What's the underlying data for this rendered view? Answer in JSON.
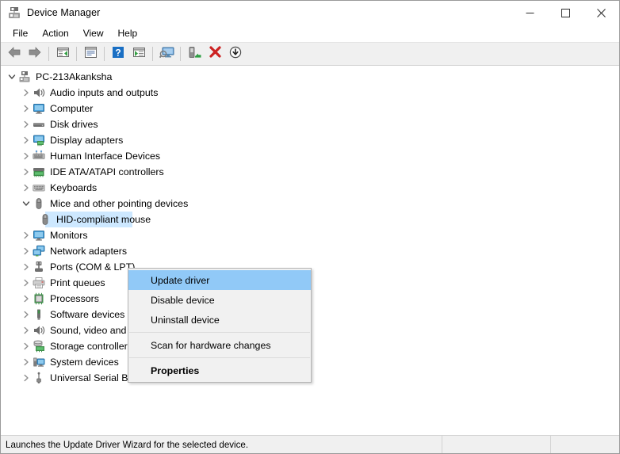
{
  "window": {
    "title": "Device Manager",
    "icon": "device-manager-icon"
  },
  "titlebar_buttons": {
    "minimize": "minimize-button",
    "maximize": "maximize-button",
    "close": "close-button"
  },
  "menubar": {
    "items": [
      {
        "label": "File"
      },
      {
        "label": "Action"
      },
      {
        "label": "View"
      },
      {
        "label": "Help"
      }
    ]
  },
  "toolbar": {
    "buttons": [
      {
        "name": "back-button",
        "icon": "left-arrow-icon"
      },
      {
        "name": "forward-button",
        "icon": "right-arrow-icon"
      },
      {
        "name": "separator-1",
        "icon": "separator"
      },
      {
        "name": "show-hide-console-tree-button",
        "icon": "console-tree-icon"
      },
      {
        "name": "separator-2",
        "icon": "separator"
      },
      {
        "name": "properties-button",
        "icon": "properties-window-icon"
      },
      {
        "name": "separator-3",
        "icon": "separator"
      },
      {
        "name": "help-button",
        "icon": "help-question-icon"
      },
      {
        "name": "show-hide-action-pane-button",
        "icon": "action-pane-icon"
      },
      {
        "name": "separator-4",
        "icon": "separator"
      },
      {
        "name": "scan-for-hardware-changes-button",
        "icon": "scan-monitor-icon"
      },
      {
        "name": "separator-5",
        "icon": "separator"
      },
      {
        "name": "update-driver-button",
        "icon": "update-driver-icon"
      },
      {
        "name": "uninstall-device-button",
        "icon": "red-x-icon"
      },
      {
        "name": "disable-device-button",
        "icon": "down-arrow-circle-icon"
      }
    ]
  },
  "tree": {
    "root": {
      "label": "PC-213Akanksha",
      "icon": "computer-root-icon",
      "expanded": true
    },
    "nodes": [
      {
        "label": "Audio inputs and outputs",
        "icon": "speaker-icon",
        "expanded": false,
        "level": 1
      },
      {
        "label": "Computer",
        "icon": "monitor-icon",
        "expanded": false,
        "level": 1
      },
      {
        "label": "Disk drives",
        "icon": "disk-drive-icon",
        "expanded": false,
        "level": 1
      },
      {
        "label": "Display adapters",
        "icon": "display-adapter-icon",
        "expanded": false,
        "level": 1
      },
      {
        "label": "Human Interface Devices",
        "icon": "hid-icon",
        "expanded": false,
        "level": 1
      },
      {
        "label": "IDE ATA/ATAPI controllers",
        "icon": "ide-controller-icon",
        "expanded": false,
        "level": 1
      },
      {
        "label": "Keyboards",
        "icon": "keyboard-icon",
        "expanded": false,
        "level": 1
      },
      {
        "label": "Mice and other pointing devices",
        "icon": "mouse-icon",
        "expanded": true,
        "level": 1
      },
      {
        "label": "HID-compliant mouse",
        "icon": "mouse-icon",
        "expanded": null,
        "level": 2,
        "selected": true
      },
      {
        "label": "Monitors",
        "icon": "monitor-icon",
        "expanded": false,
        "level": 1
      },
      {
        "label": "Network adapters",
        "icon": "network-adapter-icon",
        "expanded": false,
        "level": 1
      },
      {
        "label": "Ports (COM & LPT)",
        "icon": "port-icon",
        "expanded": false,
        "level": 1
      },
      {
        "label": "Print queues",
        "icon": "printer-icon",
        "expanded": false,
        "level": 1
      },
      {
        "label": "Processors",
        "icon": "processor-icon",
        "expanded": false,
        "level": 1
      },
      {
        "label": "Software devices",
        "icon": "software-device-icon",
        "expanded": false,
        "level": 1
      },
      {
        "label": "Sound, video and game controllers",
        "icon": "speaker-icon",
        "expanded": false,
        "level": 1
      },
      {
        "label": "Storage controllers",
        "icon": "storage-controller-icon",
        "expanded": false,
        "level": 1
      },
      {
        "label": "System devices",
        "icon": "system-device-icon",
        "expanded": false,
        "level": 1
      },
      {
        "label": "Universal Serial Bus controllers",
        "icon": "usb-icon",
        "expanded": false,
        "level": 1
      }
    ]
  },
  "context_menu": {
    "items": [
      {
        "label": "Update driver",
        "highlighted": true,
        "bold": false
      },
      {
        "label": "Disable device",
        "highlighted": false,
        "bold": false
      },
      {
        "label": "Uninstall device",
        "highlighted": false,
        "bold": false
      },
      {
        "label": "Scan for hardware changes",
        "highlighted": false,
        "bold": false
      },
      {
        "label": "Properties",
        "highlighted": false,
        "bold": true
      }
    ]
  },
  "statusbar": {
    "message": "Launches the Update Driver Wizard for the selected device.",
    "cell_2": "",
    "cell_3": ""
  },
  "colors": {
    "selection_blue": "#cde8ff",
    "menu_highlight": "#91c9f7",
    "toolbar_bg": "#f0f0f0",
    "menu_bg": "#f1f1f1"
  }
}
